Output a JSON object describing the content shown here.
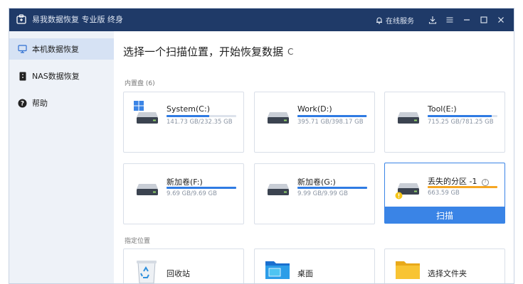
{
  "titlebar": {
    "title": "易我数据恢复 专业版 终身",
    "service_label": "在线服务",
    "background": "#1f3a68"
  },
  "sidebar": {
    "items": [
      {
        "label": "本机数据恢复",
        "icon": "computer-icon",
        "active": true
      },
      {
        "label": "NAS数据恢复",
        "icon": "nas-icon",
        "active": false
      },
      {
        "label": "帮助",
        "icon": "help-icon",
        "active": false
      }
    ]
  },
  "main": {
    "heading": "选择一个扫描位置，开始恢复数据",
    "refresh_glyph": "C",
    "internal_label": "内置盘",
    "internal_count": "(6)",
    "specified_label": "指定位置",
    "accent": "#3a84e6"
  },
  "drives": [
    {
      "name": "System(C:)",
      "size": "141.73 GB/232.35 GB",
      "used": 0.61,
      "windows": true
    },
    {
      "name": "Work(D:)",
      "size": "395.71 GB/398.17 GB",
      "used": 0.99
    },
    {
      "name": "Tool(E:)",
      "size": "715.25 GB/781.25 GB",
      "used": 0.92
    },
    {
      "name": "新加卷(F:)",
      "size": "9.69 GB/9.69 GB",
      "used": 1.0
    },
    {
      "name": "新加卷(G:)",
      "size": "9.99 GB/9.99 GB",
      "used": 1.0
    },
    {
      "name": "丢失的分区 -1",
      "size": "663.59 GB",
      "used": 1.0,
      "lost": true,
      "help_glyph": "?"
    }
  ],
  "scan_button": "扫描",
  "locations": [
    {
      "label": "回收站",
      "icon": "recycle-bin-icon"
    },
    {
      "label": "桌面",
      "icon": "desktop-folder-icon"
    },
    {
      "label": "选择文件夹",
      "icon": "folder-icon"
    }
  ]
}
